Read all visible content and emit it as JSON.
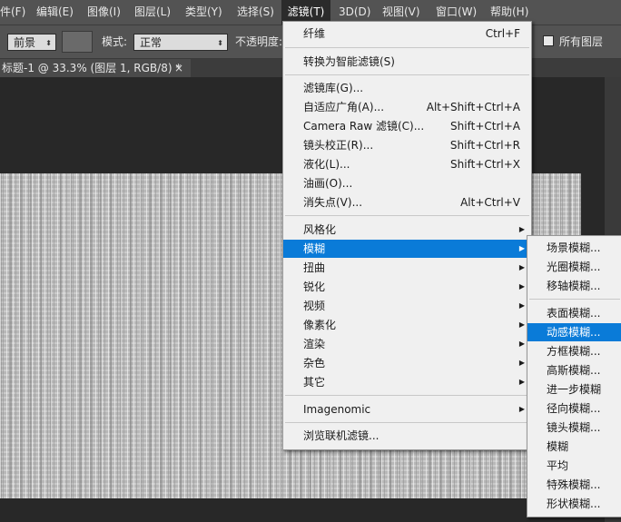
{
  "menubar": {
    "items": [
      {
        "label": "件(F)"
      },
      {
        "label": "编辑(E)"
      },
      {
        "label": "图像(I)"
      },
      {
        "label": "图层(L)"
      },
      {
        "label": "类型(Y)"
      },
      {
        "label": "选择(S)"
      },
      {
        "label": "滤镜(T)",
        "active": true
      },
      {
        "label": "3D(D)"
      },
      {
        "label": "视图(V)"
      },
      {
        "label": "窗口(W)"
      },
      {
        "label": "帮助(H)"
      }
    ]
  },
  "options": {
    "source_value": "前景",
    "mode_label": "模式:",
    "mode_value": "正常",
    "opacity_label": "不透明度:",
    "all_layers_label": "所有图层"
  },
  "document_tab": {
    "title": "标题-1 @ 33.3% (图层 1, RGB/8) *",
    "close": "×"
  },
  "filter_menu": {
    "items": [
      {
        "label": "纤维",
        "shortcut": "Ctrl+F"
      },
      {
        "label": "转换为智能滤镜(S)",
        "shortcut": ""
      },
      {
        "label": "滤镜库(G)...",
        "shortcut": ""
      },
      {
        "label": "自适应广角(A)...",
        "shortcut": "Alt+Shift+Ctrl+A"
      },
      {
        "label": "Camera Raw 滤镜(C)...",
        "shortcut": "Shift+Ctrl+A"
      },
      {
        "label": "镜头校正(R)...",
        "shortcut": "Shift+Ctrl+R"
      },
      {
        "label": "液化(L)...",
        "shortcut": "Shift+Ctrl+X"
      },
      {
        "label": "油画(O)...",
        "shortcut": ""
      },
      {
        "label": "消失点(V)...",
        "shortcut": "Alt+Ctrl+V"
      },
      {
        "label": "风格化",
        "submenu": true
      },
      {
        "label": "模糊",
        "submenu": true,
        "highlighted": true
      },
      {
        "label": "扭曲",
        "submenu": true
      },
      {
        "label": "锐化",
        "submenu": true
      },
      {
        "label": "视频",
        "submenu": true
      },
      {
        "label": "像素化",
        "submenu": true
      },
      {
        "label": "渲染",
        "submenu": true
      },
      {
        "label": "杂色",
        "submenu": true
      },
      {
        "label": "其它",
        "submenu": true
      },
      {
        "label": "Imagenomic",
        "submenu": true
      },
      {
        "label": "浏览联机滤镜...",
        "shortcut": ""
      }
    ]
  },
  "blur_submenu": {
    "items": [
      {
        "label": "场景模糊..."
      },
      {
        "label": "光圈模糊..."
      },
      {
        "label": "移轴模糊..."
      },
      {
        "label": "表面模糊..."
      },
      {
        "label": "动感模糊...",
        "highlighted": true
      },
      {
        "label": "方框模糊..."
      },
      {
        "label": "高斯模糊..."
      },
      {
        "label": "进一步模糊"
      },
      {
        "label": "径向模糊..."
      },
      {
        "label": "镜头模糊..."
      },
      {
        "label": "模糊"
      },
      {
        "label": "平均"
      },
      {
        "label": "特殊模糊..."
      },
      {
        "label": "形状模糊..."
      }
    ]
  },
  "icons": {
    "submenu_arrow": "▶",
    "dropdown_arrow": "⬍"
  },
  "colors": {
    "highlight": "#0a7bd8",
    "menu_bg": "#f0f0f0",
    "chrome_bg": "#535353"
  }
}
